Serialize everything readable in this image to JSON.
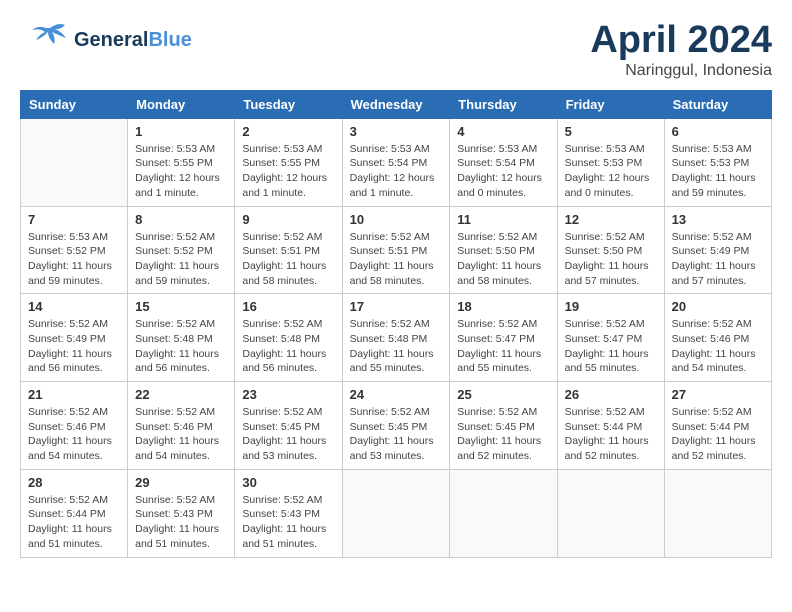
{
  "header": {
    "logo_general": "General",
    "logo_blue": "Blue",
    "month_title": "April 2024",
    "location": "Naringgul, Indonesia"
  },
  "days_of_week": [
    "Sunday",
    "Monday",
    "Tuesday",
    "Wednesday",
    "Thursday",
    "Friday",
    "Saturday"
  ],
  "weeks": [
    [
      {
        "day": "",
        "info": ""
      },
      {
        "day": "1",
        "info": "Sunrise: 5:53 AM\nSunset: 5:55 PM\nDaylight: 12 hours\nand 1 minute."
      },
      {
        "day": "2",
        "info": "Sunrise: 5:53 AM\nSunset: 5:55 PM\nDaylight: 12 hours\nand 1 minute."
      },
      {
        "day": "3",
        "info": "Sunrise: 5:53 AM\nSunset: 5:54 PM\nDaylight: 12 hours\nand 1 minute."
      },
      {
        "day": "4",
        "info": "Sunrise: 5:53 AM\nSunset: 5:54 PM\nDaylight: 12 hours\nand 0 minutes."
      },
      {
        "day": "5",
        "info": "Sunrise: 5:53 AM\nSunset: 5:53 PM\nDaylight: 12 hours\nand 0 minutes."
      },
      {
        "day": "6",
        "info": "Sunrise: 5:53 AM\nSunset: 5:53 PM\nDaylight: 11 hours\nand 59 minutes."
      }
    ],
    [
      {
        "day": "7",
        "info": "Sunrise: 5:53 AM\nSunset: 5:52 PM\nDaylight: 11 hours\nand 59 minutes."
      },
      {
        "day": "8",
        "info": "Sunrise: 5:52 AM\nSunset: 5:52 PM\nDaylight: 11 hours\nand 59 minutes."
      },
      {
        "day": "9",
        "info": "Sunrise: 5:52 AM\nSunset: 5:51 PM\nDaylight: 11 hours\nand 58 minutes."
      },
      {
        "day": "10",
        "info": "Sunrise: 5:52 AM\nSunset: 5:51 PM\nDaylight: 11 hours\nand 58 minutes."
      },
      {
        "day": "11",
        "info": "Sunrise: 5:52 AM\nSunset: 5:50 PM\nDaylight: 11 hours\nand 58 minutes."
      },
      {
        "day": "12",
        "info": "Sunrise: 5:52 AM\nSunset: 5:50 PM\nDaylight: 11 hours\nand 57 minutes."
      },
      {
        "day": "13",
        "info": "Sunrise: 5:52 AM\nSunset: 5:49 PM\nDaylight: 11 hours\nand 57 minutes."
      }
    ],
    [
      {
        "day": "14",
        "info": "Sunrise: 5:52 AM\nSunset: 5:49 PM\nDaylight: 11 hours\nand 56 minutes."
      },
      {
        "day": "15",
        "info": "Sunrise: 5:52 AM\nSunset: 5:48 PM\nDaylight: 11 hours\nand 56 minutes."
      },
      {
        "day": "16",
        "info": "Sunrise: 5:52 AM\nSunset: 5:48 PM\nDaylight: 11 hours\nand 56 minutes."
      },
      {
        "day": "17",
        "info": "Sunrise: 5:52 AM\nSunset: 5:48 PM\nDaylight: 11 hours\nand 55 minutes."
      },
      {
        "day": "18",
        "info": "Sunrise: 5:52 AM\nSunset: 5:47 PM\nDaylight: 11 hours\nand 55 minutes."
      },
      {
        "day": "19",
        "info": "Sunrise: 5:52 AM\nSunset: 5:47 PM\nDaylight: 11 hours\nand 55 minutes."
      },
      {
        "day": "20",
        "info": "Sunrise: 5:52 AM\nSunset: 5:46 PM\nDaylight: 11 hours\nand 54 minutes."
      }
    ],
    [
      {
        "day": "21",
        "info": "Sunrise: 5:52 AM\nSunset: 5:46 PM\nDaylight: 11 hours\nand 54 minutes."
      },
      {
        "day": "22",
        "info": "Sunrise: 5:52 AM\nSunset: 5:46 PM\nDaylight: 11 hours\nand 54 minutes."
      },
      {
        "day": "23",
        "info": "Sunrise: 5:52 AM\nSunset: 5:45 PM\nDaylight: 11 hours\nand 53 minutes."
      },
      {
        "day": "24",
        "info": "Sunrise: 5:52 AM\nSunset: 5:45 PM\nDaylight: 11 hours\nand 53 minutes."
      },
      {
        "day": "25",
        "info": "Sunrise: 5:52 AM\nSunset: 5:45 PM\nDaylight: 11 hours\nand 52 minutes."
      },
      {
        "day": "26",
        "info": "Sunrise: 5:52 AM\nSunset: 5:44 PM\nDaylight: 11 hours\nand 52 minutes."
      },
      {
        "day": "27",
        "info": "Sunrise: 5:52 AM\nSunset: 5:44 PM\nDaylight: 11 hours\nand 52 minutes."
      }
    ],
    [
      {
        "day": "28",
        "info": "Sunrise: 5:52 AM\nSunset: 5:44 PM\nDaylight: 11 hours\nand 51 minutes."
      },
      {
        "day": "29",
        "info": "Sunrise: 5:52 AM\nSunset: 5:43 PM\nDaylight: 11 hours\nand 51 minutes."
      },
      {
        "day": "30",
        "info": "Sunrise: 5:52 AM\nSunset: 5:43 PM\nDaylight: 11 hours\nand 51 minutes."
      },
      {
        "day": "",
        "info": ""
      },
      {
        "day": "",
        "info": ""
      },
      {
        "day": "",
        "info": ""
      },
      {
        "day": "",
        "info": ""
      }
    ]
  ]
}
